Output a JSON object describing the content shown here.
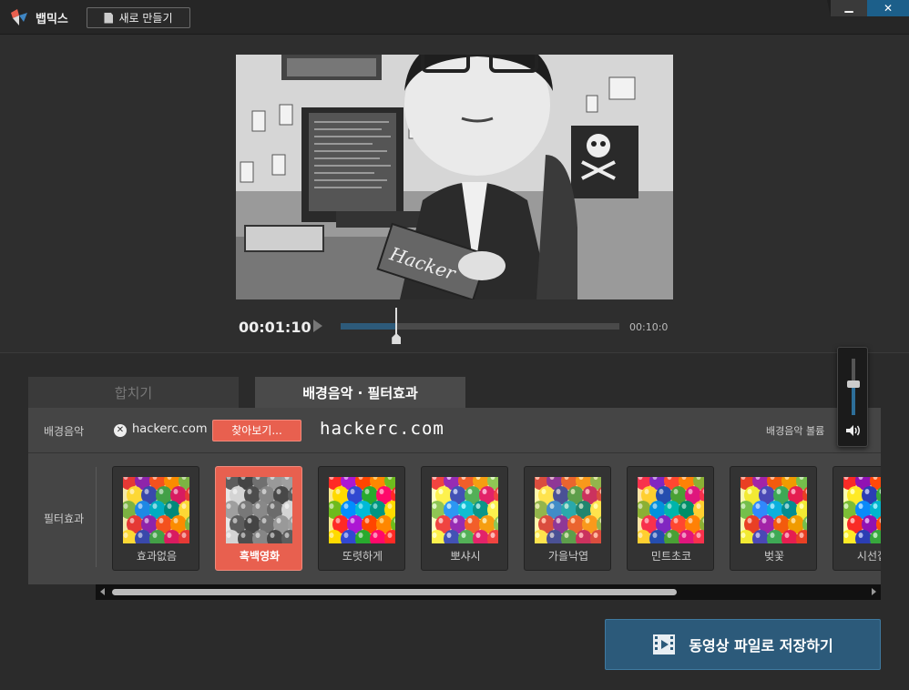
{
  "app": {
    "name": "뱁믹스",
    "new_button": "새로 만들기"
  },
  "window": {
    "minimize": "▁",
    "close": "✕"
  },
  "player": {
    "current_time": "00:01:10",
    "total_time": "00:10:0",
    "progress": 0.2
  },
  "tabs": [
    {
      "label": "합치기",
      "active": false
    },
    {
      "label": "배경음악 · 필터효과",
      "active": true
    }
  ],
  "bgm": {
    "label": "배경음악",
    "file_name": "hackerc.com",
    "browse_button": "찾아보기...",
    "watermark": "hackerc.com",
    "volume_label": "배경음악 볼륨",
    "volume_level": 0.55
  },
  "filters": {
    "label": "필터효과",
    "items": [
      {
        "name": "효과없음",
        "selected": false,
        "tone": "normal"
      },
      {
        "name": "흑백영화",
        "selected": true,
        "tone": "gray"
      },
      {
        "name": "또렷하게",
        "selected": false,
        "tone": "vivid"
      },
      {
        "name": "뽀샤시",
        "selected": false,
        "tone": "soft"
      },
      {
        "name": "가을낙엽",
        "selected": false,
        "tone": "autumn"
      },
      {
        "name": "민트초코",
        "selected": false,
        "tone": "mint"
      },
      {
        "name": "벚꽃",
        "selected": false,
        "tone": "cherry"
      },
      {
        "name": "시선집중",
        "selected": false,
        "tone": "focus"
      }
    ]
  },
  "save_button": "동영상 파일로 저장하기",
  "colors": {
    "accent": "#e8604f",
    "primary": "#2c5a7a",
    "background": "#2b2b2b"
  }
}
